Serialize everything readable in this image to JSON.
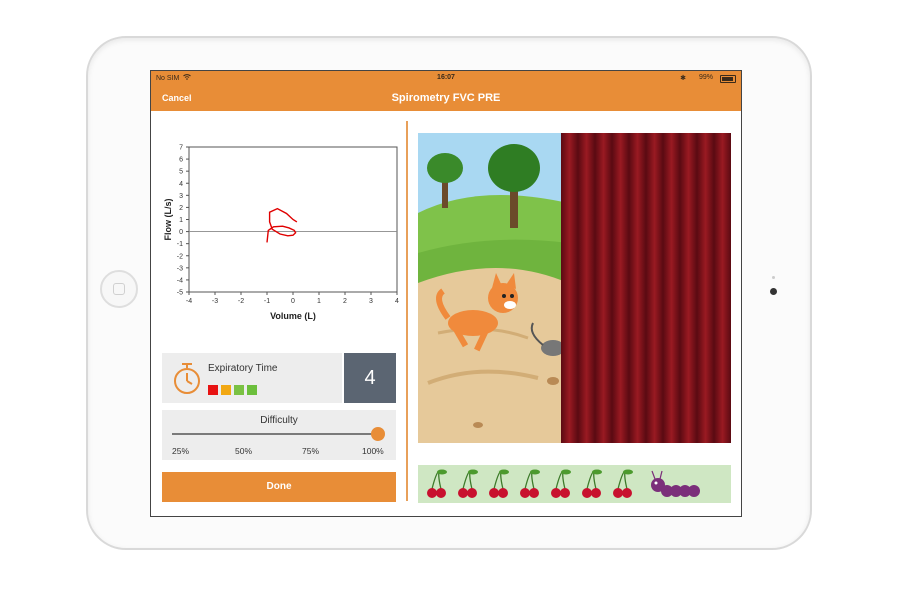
{
  "status_bar": {
    "carrier": "No SIM",
    "wifi_icon": "wifi-icon",
    "time": "16:07",
    "bluetooth_icon": "bluetooth-icon",
    "battery": "99%"
  },
  "nav": {
    "cancel_label": "Cancel",
    "title": "Spirometry FVC PRE"
  },
  "colors": {
    "accent": "#e88d37",
    "count_box": "#5b6572",
    "curve": "#e00000",
    "indicator_red": "#e81313",
    "indicator_orange": "#f2a813",
    "indicator_green": "#7ac143",
    "indicator_green2": "#6cbf3c"
  },
  "chart_data": {
    "type": "line",
    "xlabel": "Volume (L)",
    "ylabel": "Flow (L/s)",
    "xlim": [
      -4,
      4
    ],
    "ylim": [
      -5,
      7
    ],
    "xticks": [
      -4,
      -3,
      -2,
      -1,
      0,
      1,
      2,
      3,
      4
    ],
    "yticks": [
      7,
      6,
      5,
      4,
      3,
      2,
      1,
      0,
      -1,
      -2,
      -3,
      -4,
      -5
    ],
    "grid": false,
    "series": [
      {
        "x": [
          0.15,
          0.0,
          -0.25,
          -0.6,
          -0.9,
          -0.9,
          -0.8,
          -0.5,
          -0.2,
          0.0,
          0.1,
          0.05,
          -0.15,
          -0.4,
          -0.75,
          -0.95,
          -1.0
        ],
        "y": [
          0.8,
          1.0,
          1.5,
          1.9,
          1.6,
          0.8,
          0.2,
          -0.2,
          -0.35,
          -0.3,
          -0.1,
          0.1,
          0.3,
          0.45,
          0.4,
          0.1,
          -0.9
        ]
      }
    ]
  },
  "expiratory": {
    "label": "Expiratory Time",
    "clock_icon": "stopwatch-icon",
    "count": "4",
    "indicators": [
      "red",
      "orange",
      "green",
      "green"
    ]
  },
  "difficulty": {
    "label": "Difficulty",
    "ticks": [
      "25%",
      "50%",
      "75%",
      "100%"
    ],
    "value": 1.0
  },
  "done_label": "Done",
  "game": {
    "scene": "cat-chasing-mouse-illustration",
    "curtain": "red-curtain",
    "cherries_count": 7,
    "cherry_icon": "cherry-icon",
    "caterpillar_icon": "caterpillar-icon"
  }
}
